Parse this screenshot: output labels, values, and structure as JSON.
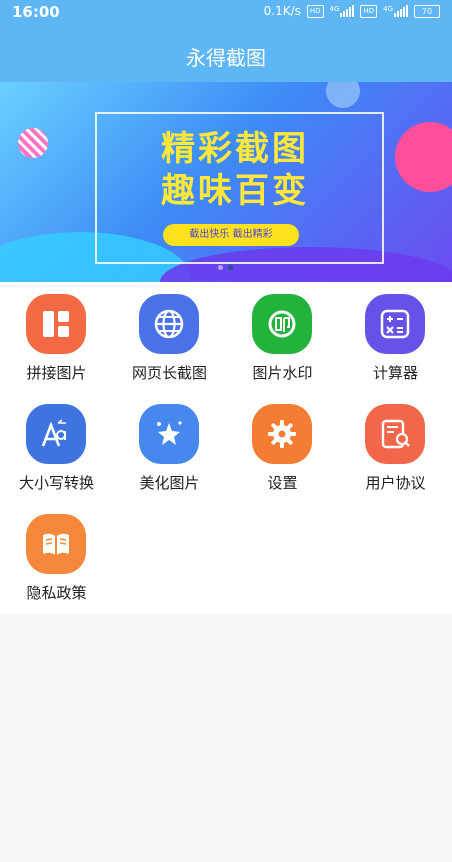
{
  "status": {
    "time": "16:00",
    "speed": "0.1K/s",
    "hd1": "HD",
    "net1": "4G",
    "hd2": "HD",
    "net2": "4G",
    "battery": "70"
  },
  "app": {
    "title": "永得截图"
  },
  "banner": {
    "line1": "精彩截图",
    "line2": "趣味百变",
    "pill": "截出快乐 截出精彩",
    "page_index": 2,
    "page_count": 2
  },
  "features": [
    {
      "label": "拼接图片",
      "icon": "grid-layout-icon",
      "color": "#f46a45"
    },
    {
      "label": "网页长截图",
      "icon": "globe-icon",
      "color": "#4a72e8"
    },
    {
      "label": "图片水印",
      "icon": "stamp-icon",
      "color": "#23b33d"
    },
    {
      "label": "计算器",
      "icon": "calculator-icon",
      "color": "#6553e8"
    },
    {
      "label": "大小写转换",
      "icon": "text-case-icon",
      "color": "#3f74e0"
    },
    {
      "label": "美化图片",
      "icon": "magic-star-icon",
      "color": "#4688ee"
    },
    {
      "label": "设置",
      "icon": "gear-icon",
      "color": "#f57c33"
    },
    {
      "label": "用户协议",
      "icon": "document-search-icon",
      "color": "#f2664a"
    },
    {
      "label": "隐私政策",
      "icon": "book-icon",
      "color": "#f5883a"
    }
  ]
}
